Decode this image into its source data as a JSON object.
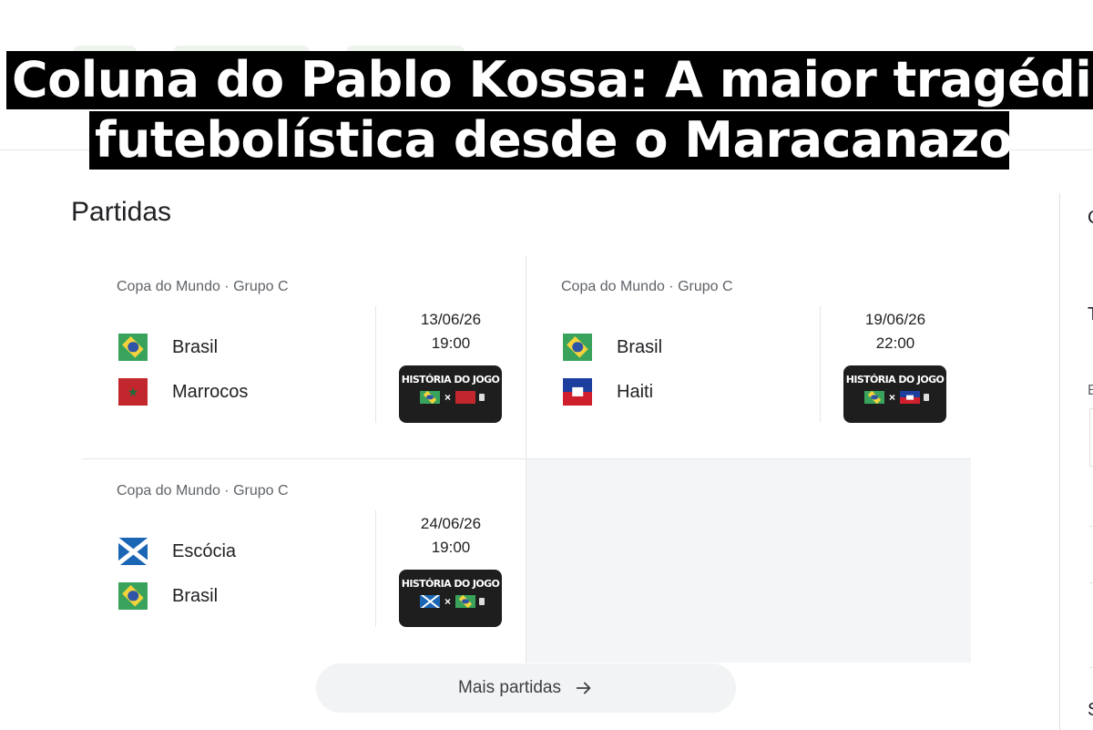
{
  "headline": {
    "line1": "Coluna do Pablo Kossa: A maior tragédia",
    "line2": "futebolística desde o Maracanazo"
  },
  "section": {
    "title": "Partidas"
  },
  "matches": [
    {
      "competition": "Copa do Mundo · Grupo C",
      "team1": {
        "name": "Brasil",
        "flag": "brazil-flag"
      },
      "team2": {
        "name": "Marrocos",
        "flag": "morocco-flag"
      },
      "date": "13/06/26",
      "time": "19:00",
      "video_title": "HISTÓRIA DO JOGO",
      "video_vs": "×"
    },
    {
      "competition": "Copa do Mundo · Grupo C",
      "team1": {
        "name": "Brasil",
        "flag": "brazil-flag"
      },
      "team2": {
        "name": "Haiti",
        "flag": "haiti-flag"
      },
      "date": "19/06/26",
      "time": "22:00",
      "video_title": "HISTÓRIA DO JOGO",
      "video_vs": "×"
    },
    {
      "competition": "Copa do Mundo · Grupo C",
      "team1": {
        "name": "Escócia",
        "flag": "scotland-flag"
      },
      "team2": {
        "name": "Brasil",
        "flag": "brazil-flag"
      },
      "date": "24/06/26",
      "time": "19:00",
      "video_title": "HISTÓRIA DO JOGO",
      "video_vs": "×"
    }
  ],
  "more_button": {
    "label": "Mais partidas",
    "icon": "arrow-right-icon"
  },
  "right_column_fragments": [
    "C",
    "T",
    "E",
    "S"
  ],
  "colors": {
    "headline_bg": "#000000",
    "headline_text": "#ffffff",
    "button_bg": "#f1f3f4",
    "muted_text": "#5f6368"
  }
}
